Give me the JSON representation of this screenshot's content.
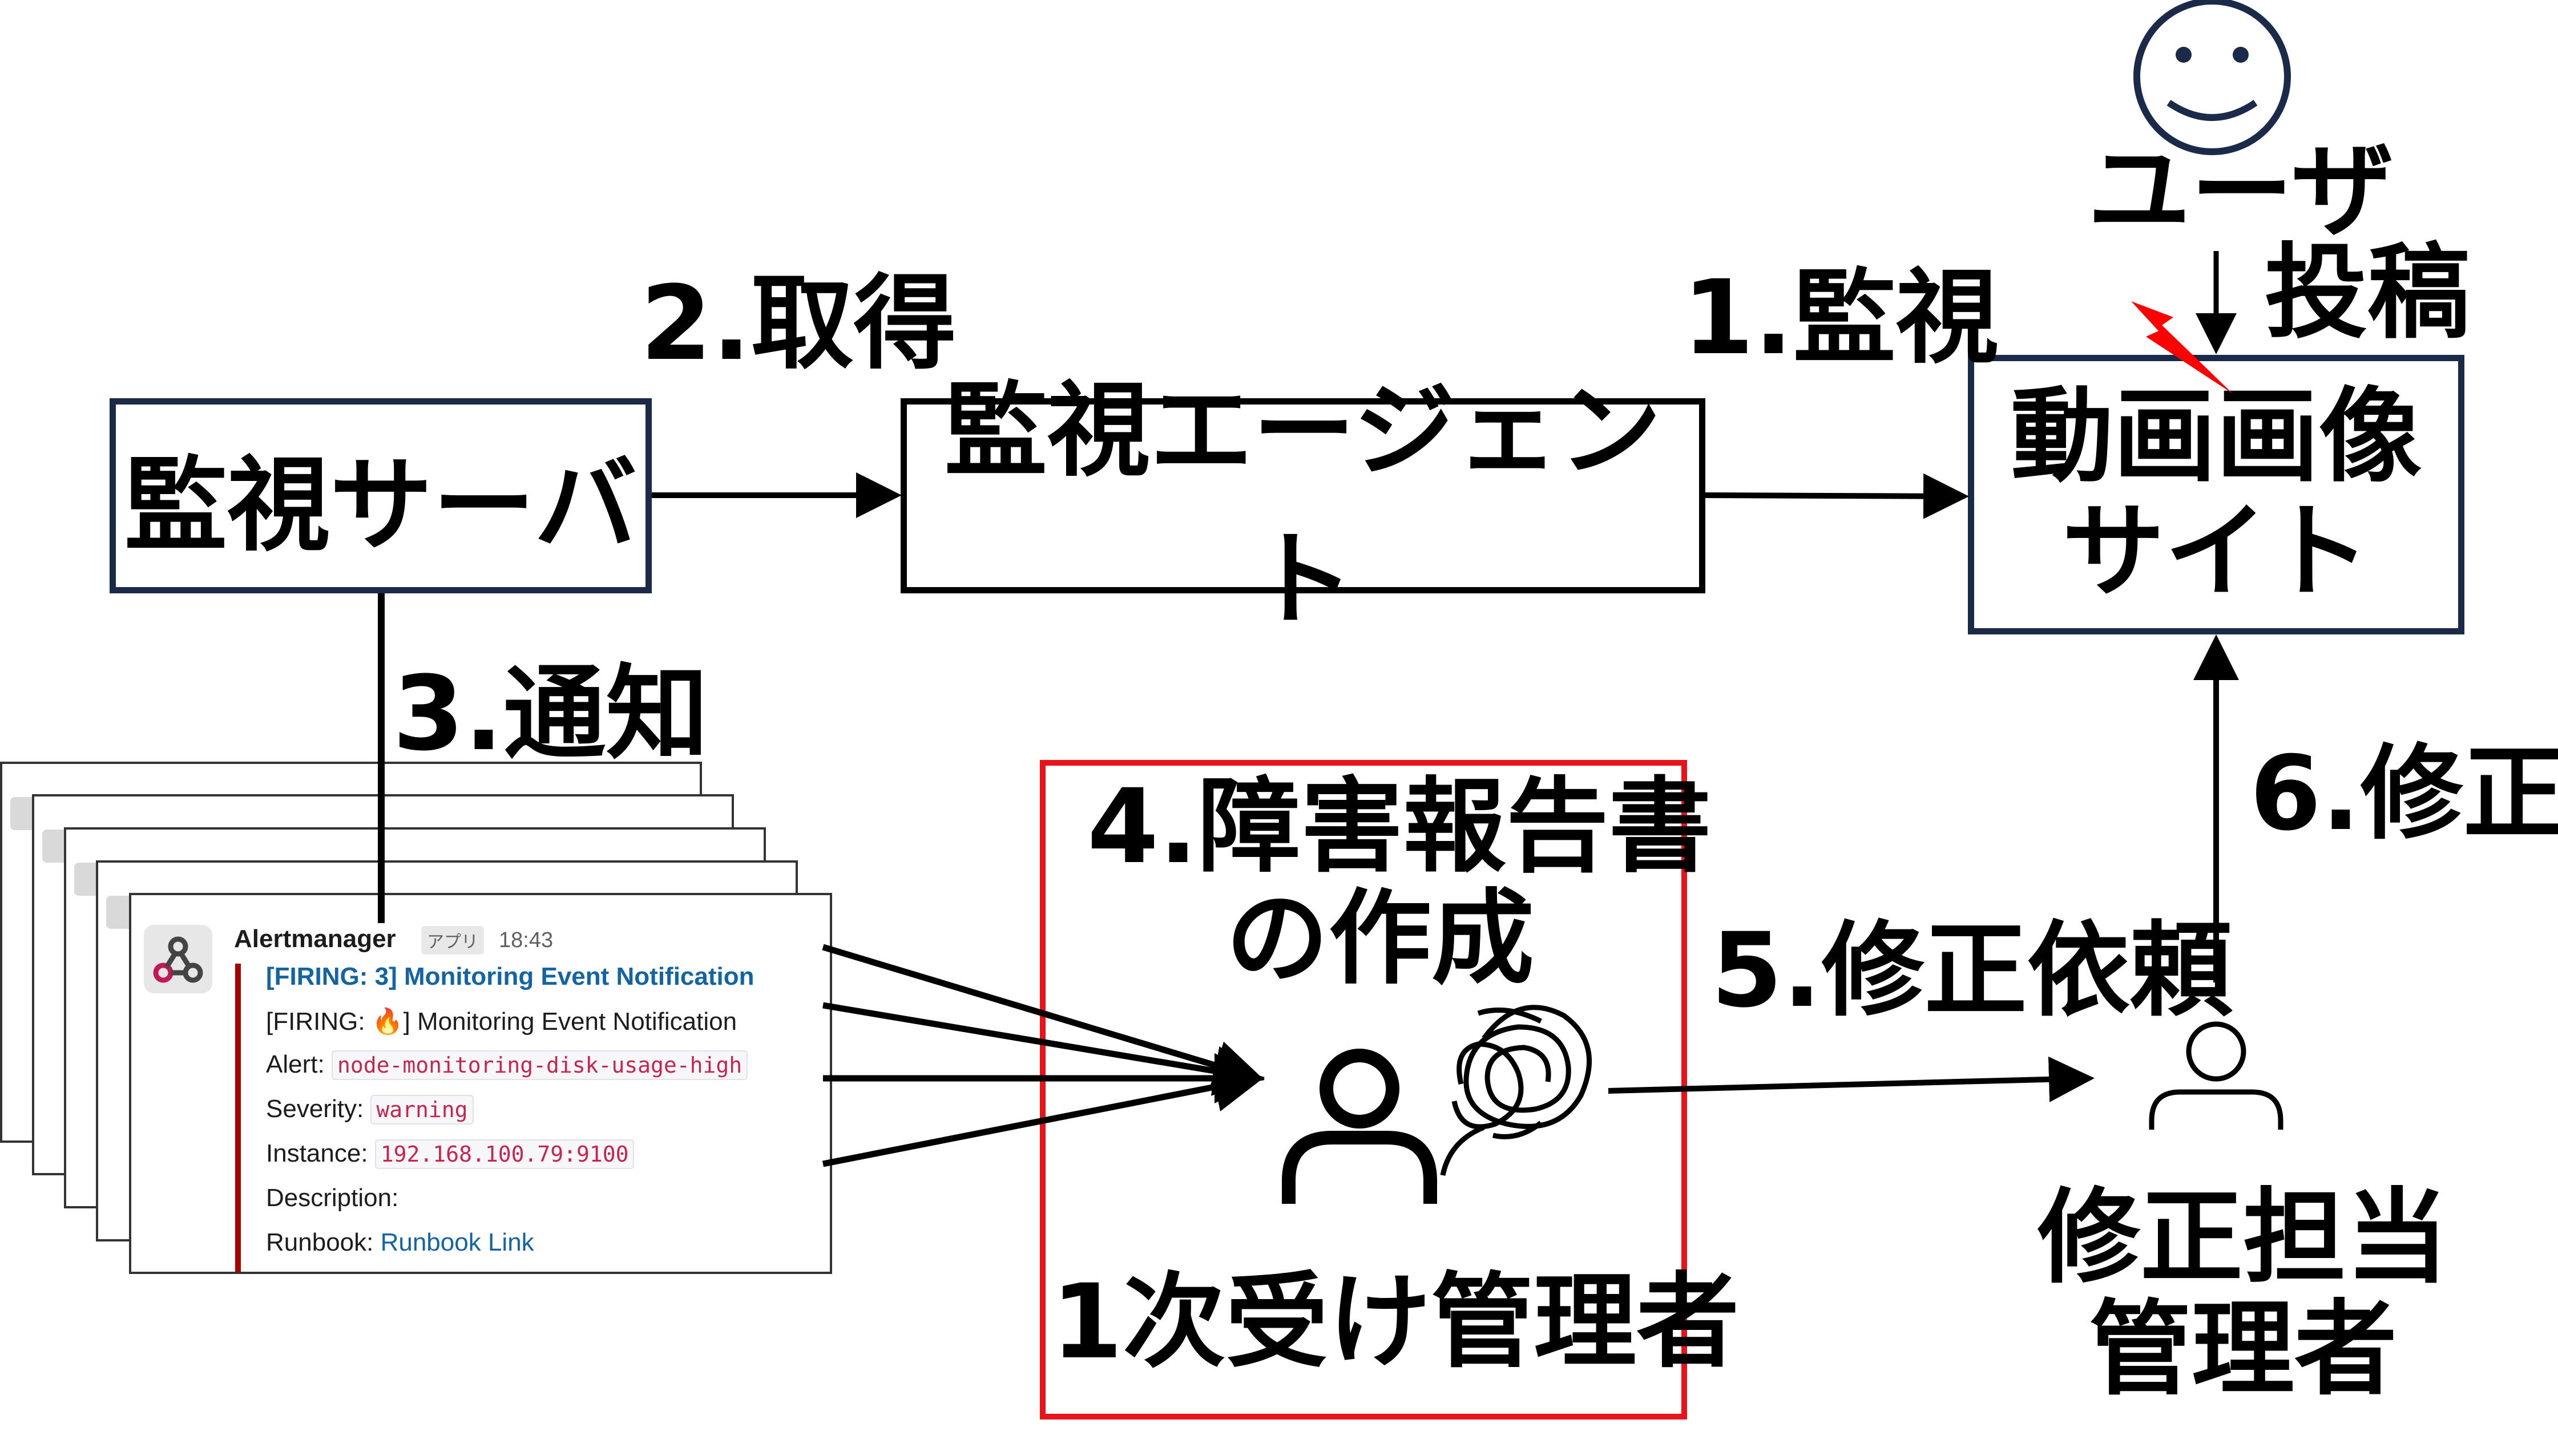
{
  "nodes": {
    "server": "監視サーバ",
    "agent": "監視エージェント",
    "site_line1": "動画画像",
    "site_line2": "サイト"
  },
  "labels": {
    "step1": "1.監視",
    "step2": "2.取得",
    "step3": "3.通知",
    "step4_line1": "4.障害報告書",
    "step4_line2": "の作成",
    "step5": "5.修正依頼",
    "step6": "6.修正",
    "post": "投稿",
    "user": "ユーザ",
    "first_admin": "1次受け管理者",
    "fix_admin_line1": "修正担当",
    "fix_admin_line2": "管理者"
  },
  "slack": {
    "sender": "Alertmanager",
    "app_badge": "アプリ",
    "time": "18:43",
    "title": "[FIRING: 3] Monitoring Event Notification",
    "firing_prefix": "[FIRING: ",
    "firing_emoji": "🔥",
    "firing_suffix": "] Monitoring Event Notification",
    "alert_label": "Alert:",
    "alert_value": "node-monitoring-disk-usage-high",
    "severity_label": "Severity:",
    "severity_value": "warning",
    "instance_label": "Instance:",
    "instance_value": "192.168.100.79:9100",
    "description_label": "Description:",
    "runbook_label": "Runbook:",
    "runbook_value": "Runbook Link"
  },
  "colors": {
    "navy_border": "#1c2a4a",
    "red_box": "#e8141b",
    "lightning": "#ff0000",
    "alert_bar": "#a30200",
    "link": "#1264a3"
  }
}
